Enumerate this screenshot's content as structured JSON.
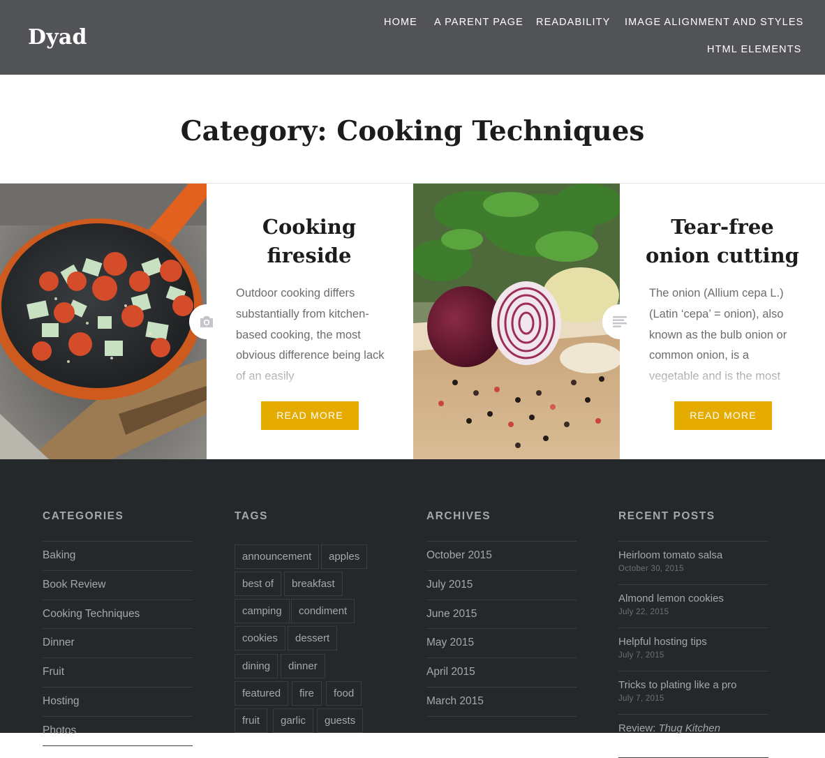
{
  "site": {
    "title": "Dyad"
  },
  "nav": [
    {
      "label": "HOME"
    },
    {
      "label": "A PARENT PAGE"
    },
    {
      "label": "READABILITY"
    },
    {
      "label": "IMAGE ALIGNMENT AND STYLES"
    },
    {
      "label": "HTML ELEMENTS"
    }
  ],
  "page": {
    "title": "Category: Cooking Techniques"
  },
  "posts": [
    {
      "title_line1": "Cooking",
      "title_line2": "fireside",
      "excerpt": "Outdoor cooking differs substantially from kitchen-based cooking, the most obvious difference being lack of an easily",
      "button": "READ MORE",
      "format_icon": "camera-icon"
    },
    {
      "title_line1": "Tear-free",
      "title_line2": "onion cutting",
      "excerpt": "The onion (Allium cepa L.) (Latin ‘cepa’ = onion), also known as the bulb onion or common onion, is a vegetable and is the most",
      "button": "READ MORE",
      "format_icon": "text-lines-icon"
    }
  ],
  "footer": {
    "categories": {
      "title": "CATEGORIES",
      "items": [
        "Baking",
        "Book Review",
        "Cooking Techniques",
        "Dinner",
        "Fruit",
        "Hosting",
        "Photos"
      ]
    },
    "tags": {
      "title": "TAGS",
      "items": [
        "announcement",
        "apples",
        "best of",
        "breakfast",
        "camping",
        "condiment",
        "cookies",
        "dessert",
        "dining",
        "dinner",
        "featured",
        "fire",
        "food",
        "fruit",
        "garlic",
        "guests"
      ]
    },
    "archives": {
      "title": "ARCHIVES",
      "items": [
        "October 2015",
        "July 2015",
        "June 2015",
        "May 2015",
        "April 2015",
        "March 2015"
      ]
    },
    "recent_posts": {
      "title": "RECENT POSTS",
      "items": [
        {
          "title": "Heirloom tomato salsa",
          "date": "October 30, 2015"
        },
        {
          "title": "Almond lemon cookies",
          "date": "July 22, 2015"
        },
        {
          "title": "Helpful hosting tips",
          "date": "July 7, 2015"
        },
        {
          "title": "Tricks to plating like a pro",
          "date": "July 7, 2015"
        },
        {
          "title_prefix": "Review: ",
          "title_emph": "Thug Kitchen"
        }
      ]
    }
  },
  "colors": {
    "header_bg": "#515356",
    "footer_bg": "#25282b",
    "accent": "#e5ab00"
  }
}
